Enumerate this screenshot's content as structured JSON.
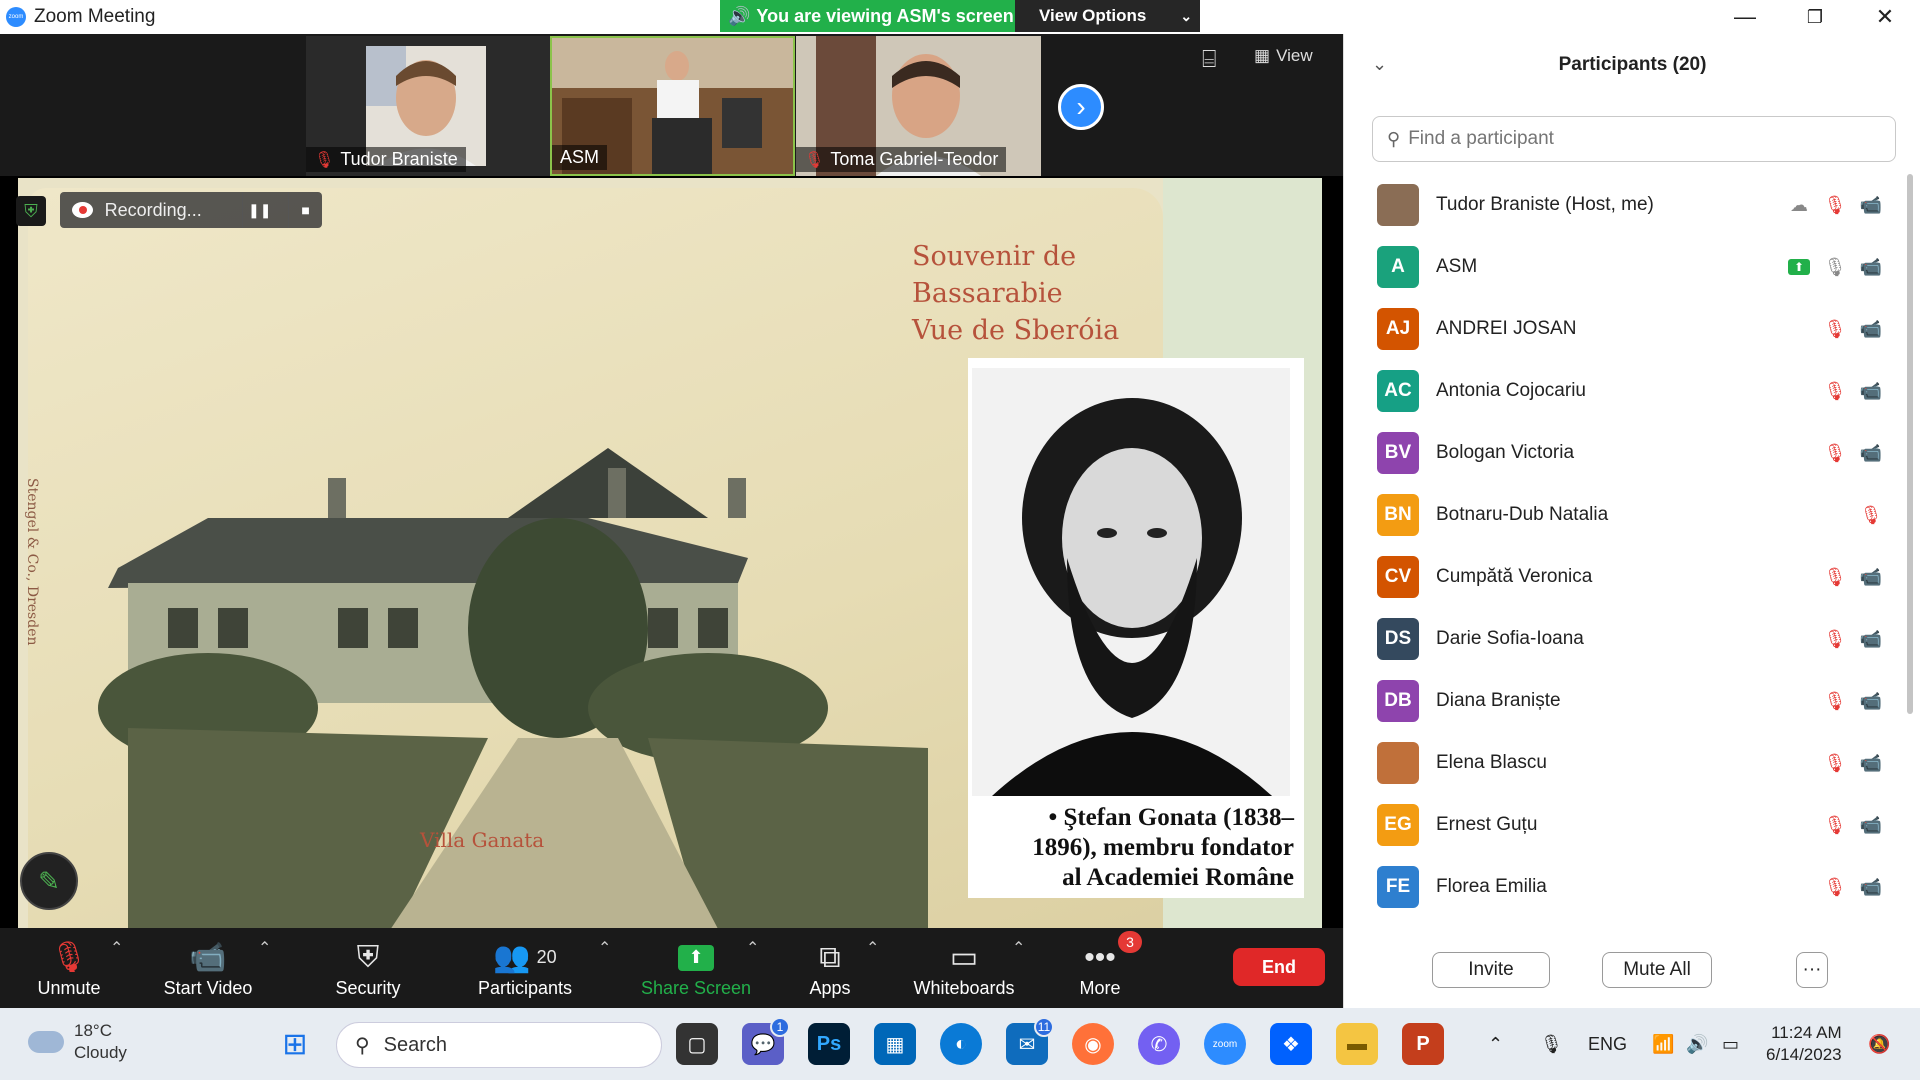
{
  "window": {
    "title": "Zoom Meeting",
    "app_icon_text": "zoom",
    "minimize_icon": "minimize-icon",
    "maximize_icon": "maximize-icon",
    "close_icon": "close-icon"
  },
  "banner": {
    "viewing_text": "You are viewing ASM's screen",
    "view_options_label": "View Options"
  },
  "video_strip": {
    "tiles": [
      {
        "name": "Tudor Braniste",
        "muted": true
      },
      {
        "name": "ASM",
        "muted": false
      },
      {
        "name": "Toma Gabriel-Teodor",
        "muted": true
      }
    ],
    "view_label": "View"
  },
  "recording": {
    "label": "Recording..."
  },
  "shared_screen": {
    "souvenir_lines": [
      "Souvenir de",
      "Bassarabie",
      "Vue de Sberóia"
    ],
    "villa_label": "Villa Ganata",
    "side_print": "Stengel & Co., Dresden",
    "caption_lines": [
      "• Ştefan Gonata (1838–",
      "1896), membru fondator",
      "al Academiei Române"
    ]
  },
  "toolbar": {
    "unmute_label": "Unmute",
    "start_video_label": "Start Video",
    "security_label": "Security",
    "participants_label": "Participants",
    "participants_count": "20",
    "share_screen_label": "Share Screen",
    "apps_label": "Apps",
    "whiteboards_label": "Whiteboards",
    "more_label": "More",
    "more_badge": "3",
    "end_label": "End"
  },
  "panel": {
    "title": "Participants (20)",
    "search_placeholder": "Find a participant",
    "participants": [
      {
        "initials": "",
        "name": "Tudor Braniste (Host, me)",
        "color": "#8a6d55",
        "photo": true
      },
      {
        "initials": "A",
        "name": "ASM",
        "color": "#1aa27c"
      },
      {
        "initials": "AJ",
        "name": "ANDREI JOSAN",
        "color": "#d35400"
      },
      {
        "initials": "AC",
        "name": "Antonia Cojocariu",
        "color": "#16a085"
      },
      {
        "initials": "BV",
        "name": "Bologan Victoria",
        "color": "#8e44ad"
      },
      {
        "initials": "BN",
        "name": "Botnaru-Dub Natalia",
        "color": "#f39c12"
      },
      {
        "initials": "CV",
        "name": "Cumpătă Veronica",
        "color": "#d35400"
      },
      {
        "initials": "DS",
        "name": "Darie Sofia-Ioana",
        "color": "#34495e"
      },
      {
        "initials": "DB",
        "name": "Diana Braniște",
        "color": "#8e44ad"
      },
      {
        "initials": "",
        "name": "Elena Blascu",
        "color": "#c0703a",
        "photo": true
      },
      {
        "initials": "EG",
        "name": "Ernest Guțu",
        "color": "#f39c12"
      },
      {
        "initials": "FE",
        "name": "Florea Emilia",
        "color": "#2e7fcf"
      }
    ],
    "invite_label": "Invite",
    "mute_all_label": "Mute All",
    "more_label": "···"
  },
  "taskbar": {
    "temperature": "18°C",
    "condition": "Cloudy",
    "search_label": "Search",
    "teams_badge": "1",
    "mail_badge": "11",
    "lang": "ENG",
    "time": "11:24 AM",
    "date": "6/14/2023"
  },
  "colors": {
    "zoom_blue": "#2d8cff",
    "share_green": "#22b04a",
    "end_red": "#e02828"
  }
}
